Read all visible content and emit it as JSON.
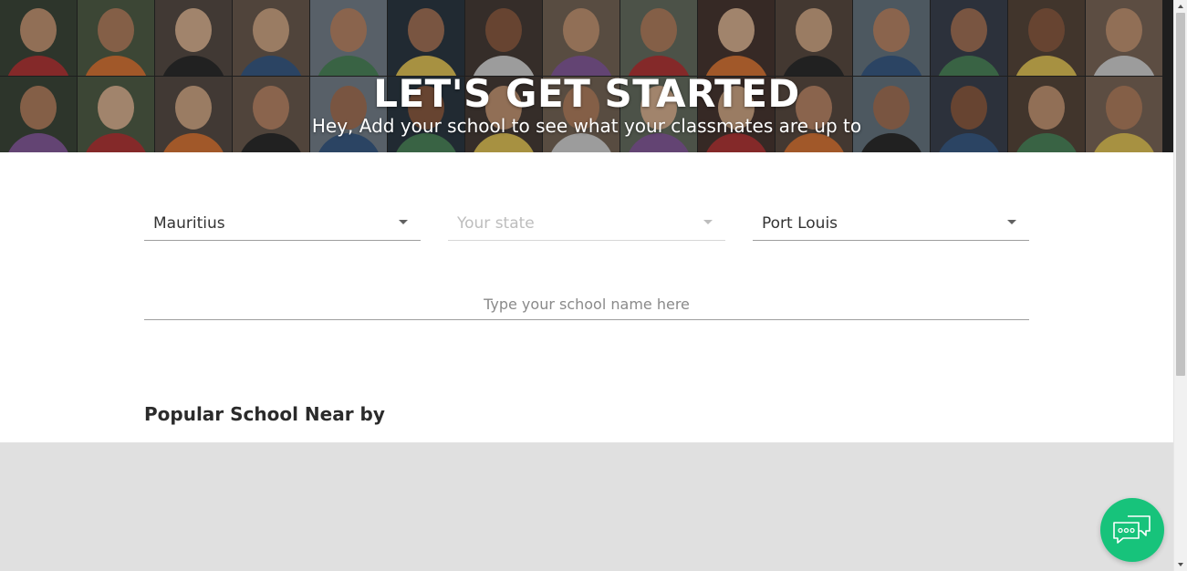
{
  "hero": {
    "title": "LET'S GET STARTED",
    "subtitle": "Hey, Add your school to see what your classmates are up to"
  },
  "form": {
    "country": {
      "value": "Mauritius"
    },
    "state": {
      "placeholder": "Your state",
      "disabled": true
    },
    "city": {
      "value": "Port Louis"
    },
    "school_search": {
      "placeholder": "Type your school name here",
      "value": ""
    }
  },
  "popular": {
    "heading": "Popular School Near by"
  },
  "chat": {
    "icon": "chat-bubbles-icon"
  },
  "colors": {
    "accent_green": "#17c37b",
    "gray_section": "#e0e0e0",
    "underline": "#9e9e9e"
  }
}
